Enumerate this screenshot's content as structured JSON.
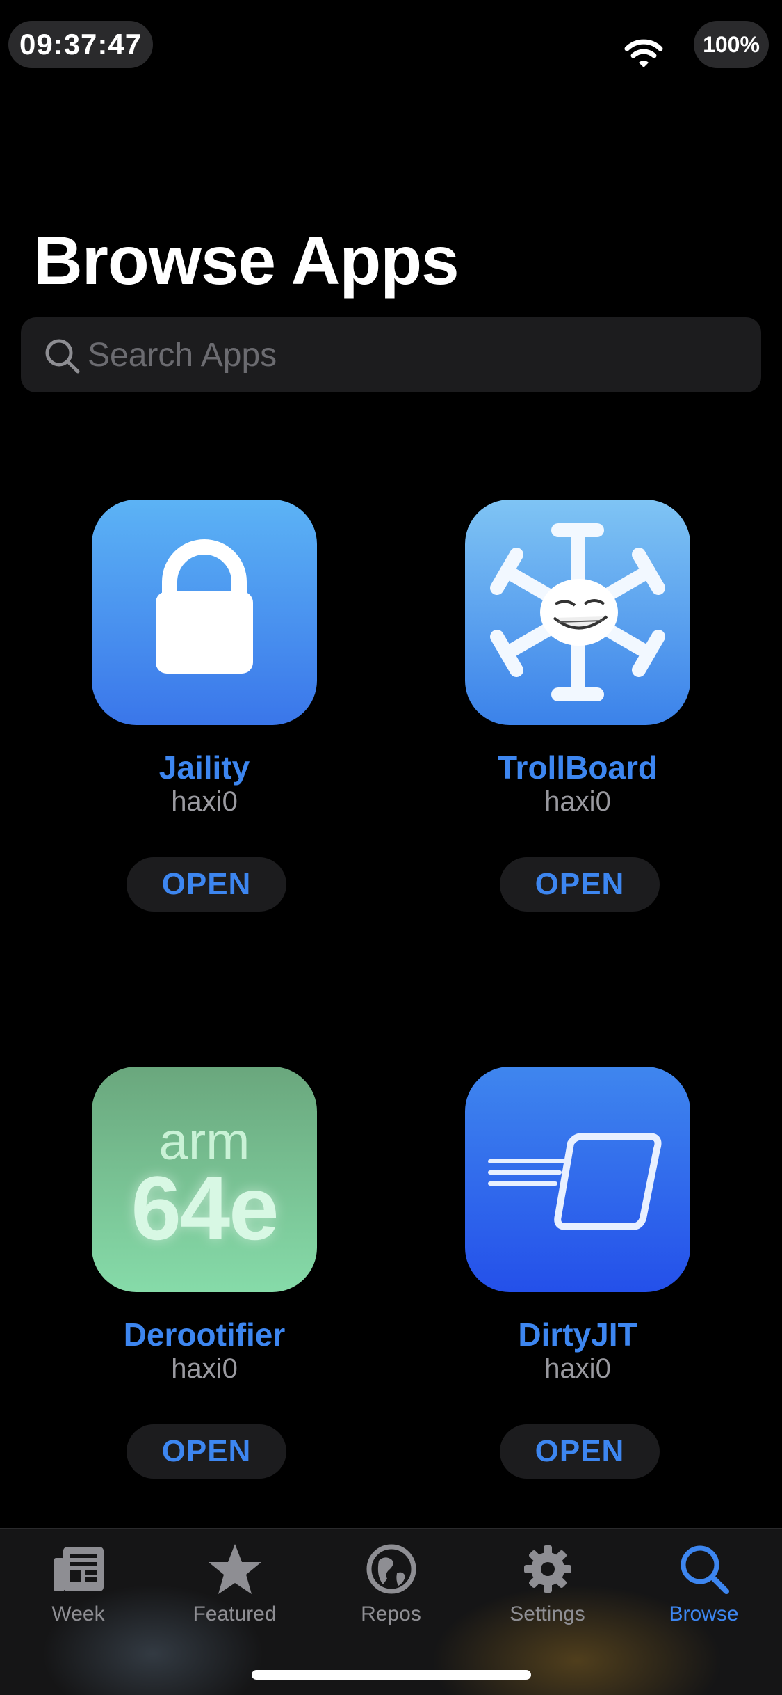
{
  "status_bar": {
    "time": "09:37:47",
    "battery": "100%"
  },
  "page_title": "Browse Apps",
  "search": {
    "placeholder": "Search Apps",
    "value": ""
  },
  "apps": [
    {
      "name": "Jaility",
      "developer": "haxi0",
      "action": "OPEN",
      "icon": "lock-icon"
    },
    {
      "name": "TrollBoard",
      "developer": "haxi0",
      "action": "OPEN",
      "icon": "troll-snowflake-icon"
    },
    {
      "name": "Derootifier",
      "developer": "haxi0",
      "action": "OPEN",
      "icon": "arm64e-icon",
      "icon_text": {
        "top": "arm",
        "bottom": "64e"
      }
    },
    {
      "name": "DirtyJIT",
      "developer": "haxi0",
      "action": "OPEN",
      "icon": "speed-tile-icon"
    }
  ],
  "tab_bar": {
    "tabs": [
      {
        "label": "Week",
        "icon": "newspaper-icon",
        "active": false
      },
      {
        "label": "Featured",
        "icon": "star-icon",
        "active": false
      },
      {
        "label": "Repos",
        "icon": "globe-icon",
        "active": false
      },
      {
        "label": "Settings",
        "icon": "gear-icon",
        "active": false
      },
      {
        "label": "Browse",
        "icon": "search-icon",
        "active": true
      }
    ]
  },
  "colors": {
    "accent": "#3d86f0",
    "background": "#000000",
    "card": "#1c1c1e",
    "secondary_text": "#9a9aa0"
  }
}
